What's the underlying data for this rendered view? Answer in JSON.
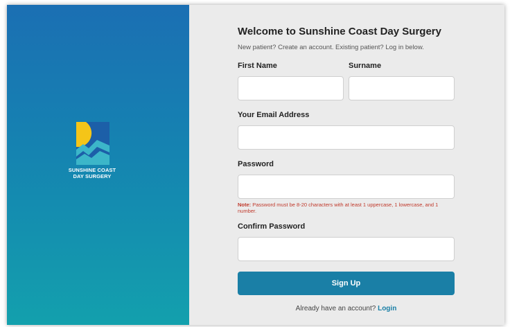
{
  "brand": {
    "name_line1": "SUNSHINE COAST",
    "name_line2": "DAY SURGERY",
    "colors": {
      "sun": "#f5c518",
      "wave_dark": "#1c5fa8",
      "wave_light": "#3cb6c9"
    }
  },
  "form": {
    "title": "Welcome to Sunshine Coast Day Surgery",
    "subtitle": "New patient? Create an account. Existing patient? Log in below.",
    "first_name": {
      "label": "First Name",
      "value": "",
      "placeholder": ""
    },
    "surname": {
      "label": "Surname",
      "value": "",
      "placeholder": ""
    },
    "email": {
      "label": "Your Email Address",
      "value": "",
      "placeholder": ""
    },
    "password": {
      "label": "Password",
      "value": "",
      "placeholder": ""
    },
    "password_note": {
      "prefix": "Note:",
      "text": " Password must be 8-20 characters with at least 1 uppercase, 1 lowercase, and 1 number."
    },
    "confirm_password": {
      "label": "Confirm Password",
      "value": "",
      "placeholder": ""
    },
    "submit_label": "Sign Up",
    "login_prompt": "Already have an account?",
    "login_link": "Login"
  },
  "theme": {
    "panel_gradient_top": "#1b6fb3",
    "panel_gradient_bottom": "#13a0ad",
    "button_color": "#1a7fa6",
    "note_color": "#c0392b",
    "form_background": "#ebebeb"
  }
}
